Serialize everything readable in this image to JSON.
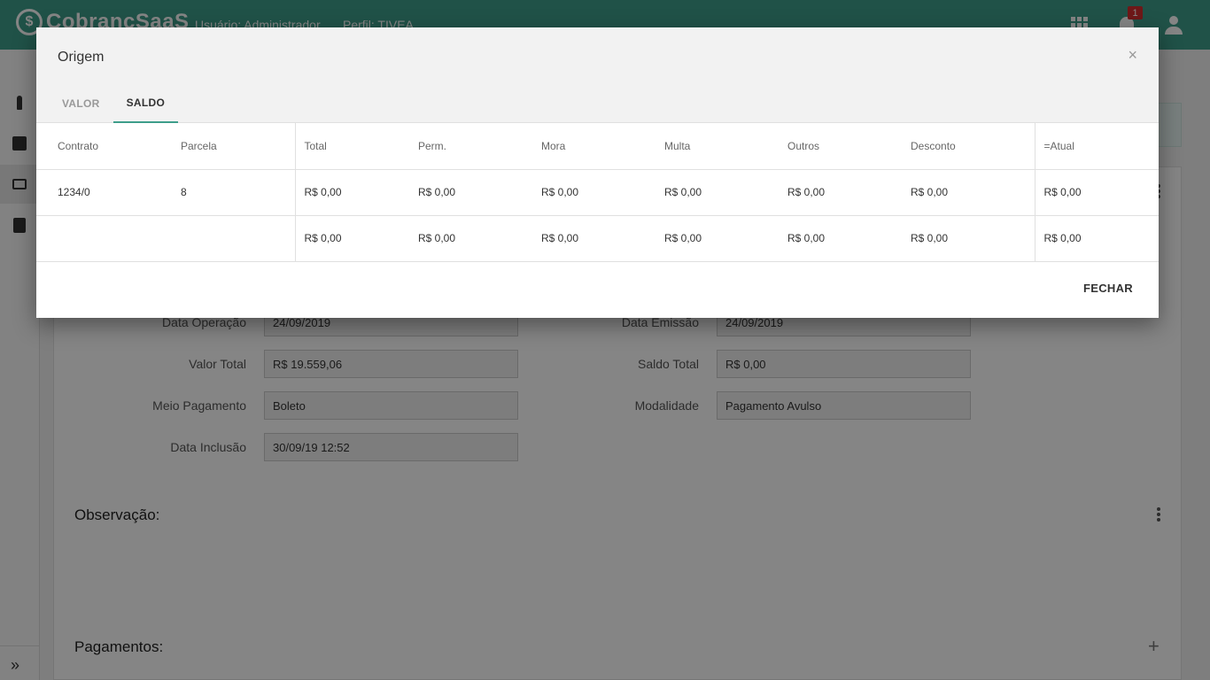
{
  "app": {
    "logo_text": "CobrancSaaS",
    "logo_symbol": "$",
    "user_label": "Usuário: Administrador",
    "profile_label": "Perfil: TIVEA",
    "notification_count": "1"
  },
  "background_form": {
    "fields": [
      {
        "label": "Data Operação",
        "value": "24/09/2019"
      },
      {
        "label": "Data Emissão",
        "value": "24/09/2019"
      },
      {
        "label": "Valor Total",
        "value": "R$ 19.559,06"
      },
      {
        "label": "Saldo Total",
        "value": "R$ 0,00"
      },
      {
        "label": "Meio Pagamento",
        "value": "Boleto"
      },
      {
        "label": "Modalidade",
        "value": "Pagamento Avulso"
      },
      {
        "label": "Data Inclusão",
        "value": "30/09/19 12:52"
      }
    ],
    "observacao_title": "Observação:",
    "pagamentos_title": "Pagamentos:"
  },
  "modal": {
    "title": "Origem",
    "close_symbol": "×",
    "tabs": [
      {
        "label": "VALOR",
        "active": false
      },
      {
        "label": "SALDO",
        "active": true
      }
    ],
    "table": {
      "headers": [
        "Contrato",
        "Parcela",
        "Total",
        "Perm.",
        "Mora",
        "Multa",
        "Outros",
        "Desconto",
        "=Atual"
      ],
      "rows": [
        [
          "1234/0",
          "8",
          "R$ 0,00",
          "R$ 0,00",
          "R$ 0,00",
          "R$ 0,00",
          "R$ 0,00",
          "R$ 0,00",
          "R$ 0,00"
        ],
        [
          "",
          "",
          "R$ 0,00",
          "R$ 0,00",
          "R$ 0,00",
          "R$ 0,00",
          "R$ 0,00",
          "R$ 0,00",
          "R$ 0,00"
        ]
      ]
    },
    "close_button_label": "FECHAR"
  },
  "colors": {
    "brand": "#3e9e8a",
    "badge": "#d32f2f"
  }
}
